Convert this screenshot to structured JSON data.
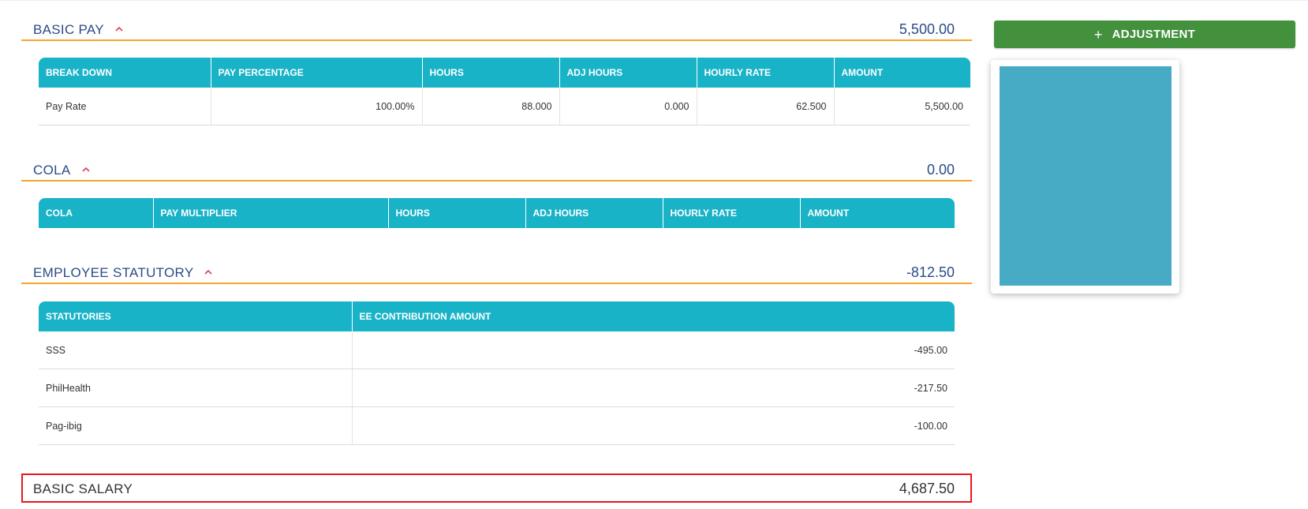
{
  "colors": {
    "section_title": "#2b4c86",
    "section_underline": "#f3a72c",
    "table_header_bg": "#19b3c8",
    "caret": "#e23b5a",
    "adjustment_button": "#43913d",
    "highlight_border": "#e8161c",
    "preview_image": "#47abc5"
  },
  "basic_pay": {
    "title": "BASIC PAY",
    "total": "5,500.00",
    "columns": [
      "BREAK DOWN",
      "PAY PERCENTAGE",
      "HOURS",
      "ADJ HOURS",
      "HOURLY RATE",
      "AMOUNT"
    ],
    "rows": [
      [
        "Pay Rate",
        "100.00%",
        "88.000",
        "0.000",
        "62.500",
        "5,500.00"
      ]
    ]
  },
  "cola": {
    "title": "COLA",
    "total": "0.00",
    "columns": [
      "COLA",
      "PAY MULTIPLIER",
      "HOURS",
      "ADJ HOURS",
      "HOURLY RATE",
      "AMOUNT"
    ],
    "rows": []
  },
  "employee_statutory": {
    "title": "EMPLOYEE STATUTORY",
    "total": "-812.50",
    "columns": [
      "STATUTORIES",
      "EE CONTRIBUTION AMOUNT"
    ],
    "rows": [
      [
        "SSS",
        "-495.00"
      ],
      [
        "PhilHealth",
        "-217.50"
      ],
      [
        "Pag-ibig",
        "-100.00"
      ]
    ]
  },
  "basic_salary": {
    "label": "BASIC SALARY",
    "value": "4,687.50"
  },
  "sidebar": {
    "adjustment_label": "ADJUSTMENT",
    "adjustment_icon": "plus-icon"
  }
}
